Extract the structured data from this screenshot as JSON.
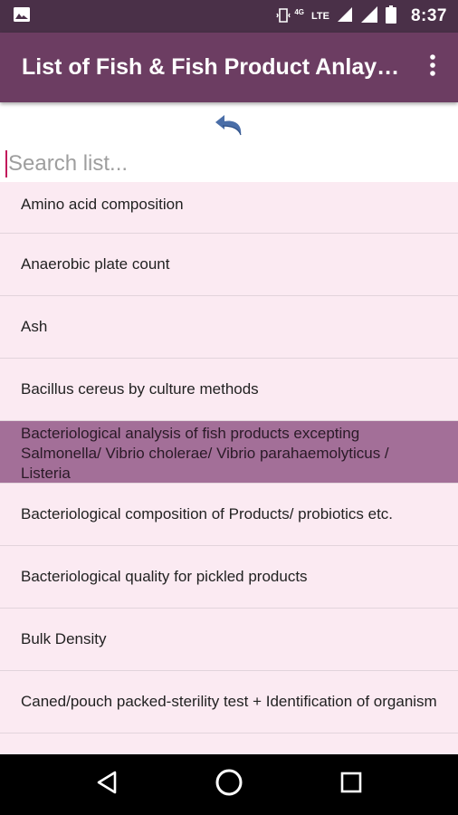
{
  "status_bar": {
    "network_label": "LTE",
    "network_sub": "4G",
    "time": "8:37",
    "icons": [
      "image-icon",
      "vibrate-icon",
      "signal-icon",
      "signal-icon",
      "battery-icon"
    ]
  },
  "app_bar": {
    "title": "List of Fish & Fish Product Anlaysis",
    "menu_icon": "overflow-menu-icon"
  },
  "undo": {
    "icon": "undo-icon"
  },
  "search": {
    "placeholder": "Search list...",
    "value": ""
  },
  "list": {
    "selected_index": 4,
    "items": [
      {
        "label": "Amino acid composition"
      },
      {
        "label": "Anaerobic plate count"
      },
      {
        "label": "Ash"
      },
      {
        "label": "Bacillus cereus by culture methods"
      },
      {
        "label": "Bacteriological analysis of fish products excepting Salmonella/ Vibrio cholerae/ Vibrio parahaemolyticus / Listeria"
      },
      {
        "label": "Bacteriological composition of Products/ probiotics etc."
      },
      {
        "label": "Bacteriological quality for pickled products"
      },
      {
        "label": "Bulk Density"
      },
      {
        "label": "Caned/pouch packed-sterility test + Identification of organism"
      }
    ]
  },
  "nav_bar": {
    "icons": [
      "back-icon",
      "home-icon",
      "recents-icon"
    ]
  },
  "colors": {
    "status_bar": "#4a3048",
    "app_bar": "#6c3d62",
    "list_background": "#fbeaf2",
    "selected_row": "#a36f98",
    "cursor": "#c2185b"
  }
}
